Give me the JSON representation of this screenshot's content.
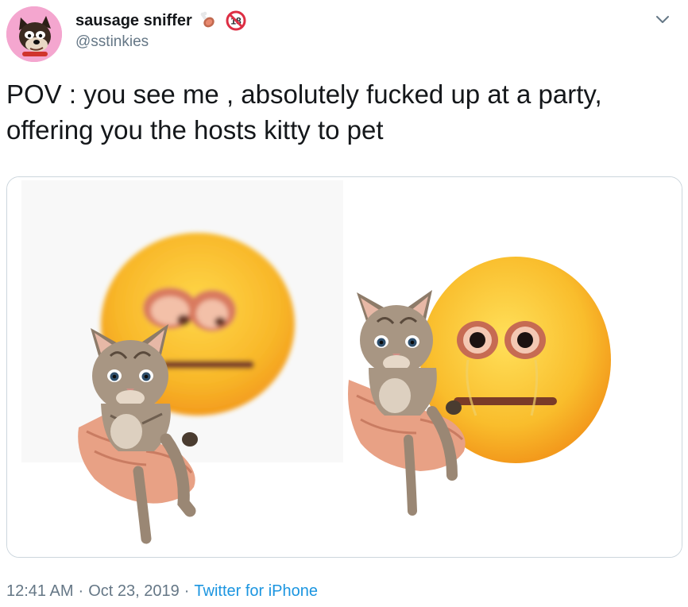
{
  "author": {
    "display_name": "sausage sniffer",
    "handle": "@sstinkies",
    "avatar_icon": "cartoon-dog-avatar-icon",
    "name_emojis": [
      "meat-emoji-icon",
      "no-under-18-emoji-icon"
    ]
  },
  "tweet": {
    "text": "POV : you see me , absolutely fucked up at a party,\noffering you the hosts kitty to pet",
    "media_description_icons": [
      "cursed-emoji-holding-kitten-left",
      "cursed-emoji-holding-kitten-right"
    ]
  },
  "meta": {
    "time": "12:41 AM",
    "separator": "·",
    "date": "Oct 23, 2019",
    "source": "Twitter for iPhone"
  },
  "colors": {
    "text": "#14171a",
    "secondary": "#657786",
    "link": "#1b95e0",
    "border": "#ccd6dd",
    "avatar_bg": "#f4a6cf"
  }
}
